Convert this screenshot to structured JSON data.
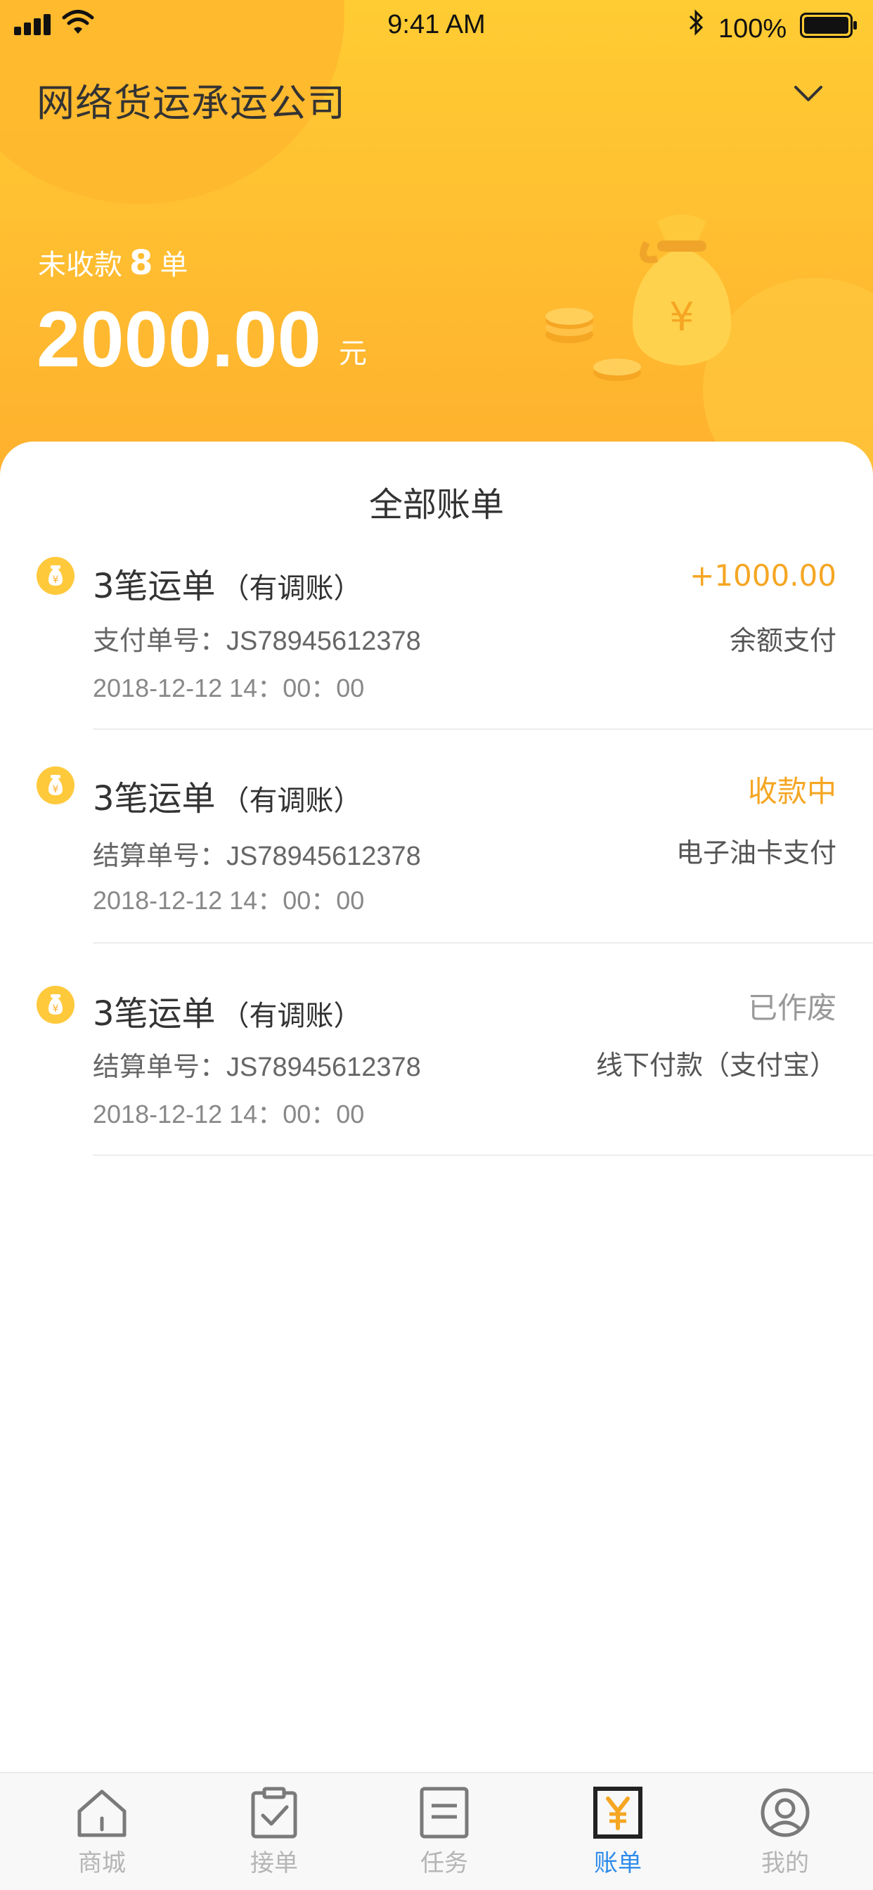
{
  "status_bar": {
    "time": "9:41 AM",
    "battery": "100%"
  },
  "header": {
    "company": "网络货运承运公司",
    "unpaid_prefix": "未收款",
    "unpaid_count": "8",
    "unpaid_suffix": "单",
    "amount": "2000.00",
    "amount_unit": "元"
  },
  "bills_title": "全部账单",
  "bills": [
    {
      "title": "3笔运单",
      "adjust": "（有调账）",
      "order_label": "支付单号：JS78945612378",
      "date": "2018-12-12  14：00：00",
      "status": "+1000.00",
      "status_color": "#F5A623",
      "method": "余额支付"
    },
    {
      "title": "3笔运单",
      "adjust": "（有调账）",
      "order_label": "结算单号：JS78945612378",
      "date": "2018-12-12  14：00：00",
      "status": "收款中",
      "status_color": "#F5A623",
      "method": "电子油卡支付"
    },
    {
      "title": "3笔运单",
      "adjust": "（有调账）",
      "order_label": "结算单号：JS78945612378",
      "date": "2018-12-12  14：00：00",
      "status": "已作废",
      "status_color": "#999999",
      "method": "线下付款（支付宝）"
    }
  ],
  "tabs": [
    {
      "label": "商城",
      "icon": "home-icon"
    },
    {
      "label": "接单",
      "icon": "clipboard-check-icon"
    },
    {
      "label": "任务",
      "icon": "task-list-icon"
    },
    {
      "label": "账单",
      "icon": "bill-yuan-icon",
      "active": true
    },
    {
      "label": "我的",
      "icon": "profile-icon"
    }
  ],
  "colors": {
    "header_top": "#FFCC33",
    "header_bottom": "#FFB02E",
    "accent": "#F5A623",
    "tab_active": "#2E8BEA"
  }
}
